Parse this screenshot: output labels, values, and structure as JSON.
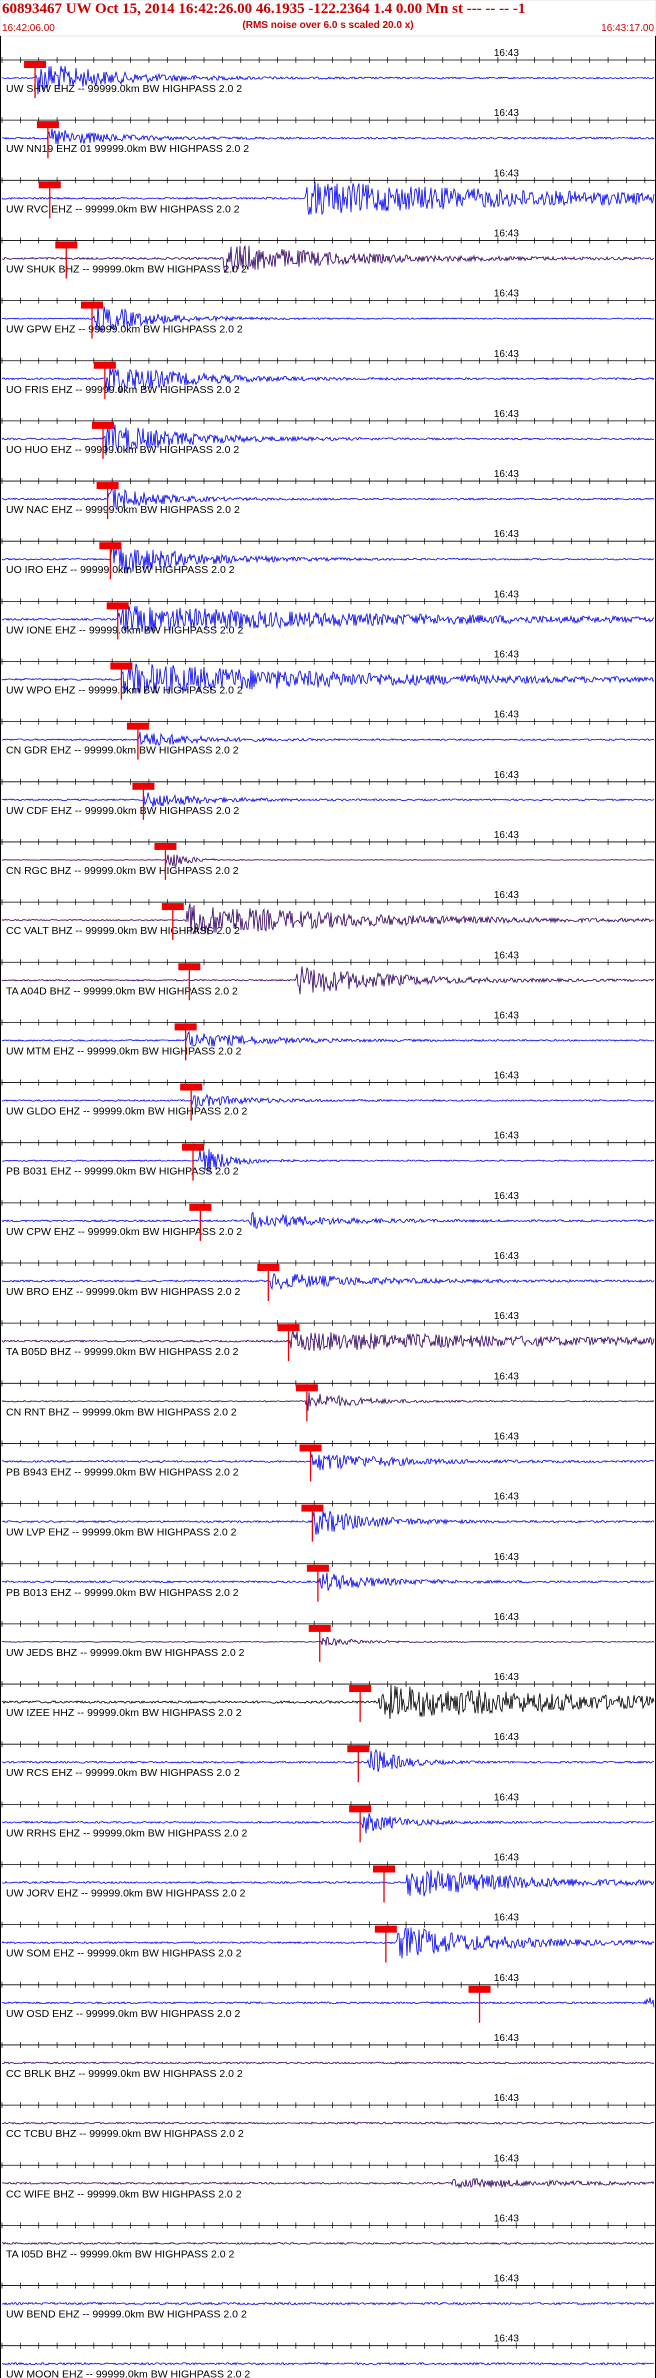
{
  "header": {
    "title": "60893467 UW Oct 15, 2014 16:42:26.00   46.1935 -122.2364  1.4 0.00 Mn st --- -- --   -1",
    "subtitle": "(RMS noise over 6.0 s scaled 20.0 x)",
    "start_time": "16:42:06.00",
    "end_time": "16:43:17.00"
  },
  "colors": {
    "header_band": "#ffffff",
    "header_text": "#cc0000",
    "pick_marker": "#ee0000",
    "axis": "#000000"
  },
  "chart_data": {
    "type": "line",
    "title": "60893467 UW Oct 15, 2014 16:42:26.00   46.1935 -122.2364  1.4 0.00 Mn st --- -- --   -1",
    "subtitle": "(RMS noise over 6.0 s scaled 20.0 x)",
    "xlim": [
      "16:42:06.00",
      "16:43:17.00"
    ],
    "x_tick_label": "16:43",
    "tick_interval_s": 2,
    "time_span_s": 71,
    "grid": false,
    "series": [
      {
        "name": "UW SHW EHZ -- 99999.0km BW  HIGHPASS  2.0  2",
        "color": "#0000ff",
        "pick_s": 3.6,
        "onset_s": 3.6,
        "amp": 1.0,
        "noise": 0.25,
        "dur": 8
      },
      {
        "name": "UW NN19 EHZ 01 99999.0km BW  HIGHPASS  2.0  2",
        "color": "#0000ff",
        "pick_s": 5.0,
        "onset_s": 5.0,
        "amp": 0.6,
        "noise": 0.3,
        "dur": 6
      },
      {
        "name": "UW RVC EHZ -- 99999.0km BW  HIGHPASS  2.0  2",
        "color": "#0000ff",
        "pick_s": 5.2,
        "onset_s": 33.0,
        "amp": 1.0,
        "noise": 0.3,
        "dur": 30
      },
      {
        "name": "UW SHUK BHZ -- 99999.0km BW  HIGHPASS  2.0  2",
        "color": "#330066",
        "pick_s": 7.0,
        "onset_s": 24.0,
        "amp": 0.9,
        "noise": 0.35,
        "dur": 12
      },
      {
        "name": "UW GPW EHZ -- 99999.0km BW  HIGHPASS  2.0  2",
        "color": "#0000ff",
        "pick_s": 9.8,
        "onset_s": 10.0,
        "amp": 0.9,
        "noise": 0.2,
        "dur": 6
      },
      {
        "name": "UO FRIS EHZ -- 99999.0km BW  HIGHPASS  2.0  2",
        "color": "#0000ff",
        "pick_s": 11.2,
        "onset_s": 11.2,
        "amp": 1.0,
        "noise": 0.3,
        "dur": 8
      },
      {
        "name": "UO HUO EHZ -- 99999.0km BW  HIGHPASS  2.0  2",
        "color": "#0000ff",
        "pick_s": 11.0,
        "onset_s": 11.0,
        "amp": 1.0,
        "noise": 0.3,
        "dur": 8
      },
      {
        "name": "UW NAC EHZ -- 99999.0km BW  HIGHPASS  2.0  2",
        "color": "#0000ff",
        "pick_s": 11.5,
        "onset_s": 11.5,
        "amp": 0.8,
        "noise": 0.3,
        "dur": 5
      },
      {
        "name": "UO IRO EHZ -- 99999.0km BW  HIGHPASS  2.0  2",
        "color": "#0000ff",
        "pick_s": 11.8,
        "onset_s": 11.8,
        "amp": 1.0,
        "noise": 0.25,
        "dur": 8
      },
      {
        "name": "UW IONE EHZ -- 99999.0km BW  HIGHPASS  2.0  2",
        "color": "#0000ff",
        "pick_s": 12.6,
        "onset_s": 12.6,
        "amp": 0.8,
        "noise": 0.3,
        "dur": 30
      },
      {
        "name": "UW WPO EHZ -- 99999.0km BW  HIGHPASS  2.0  2",
        "color": "#0000ff",
        "pick_s": 13.0,
        "onset_s": 13.0,
        "amp": 1.0,
        "noise": 0.3,
        "dur": 25
      },
      {
        "name": "CN GDR EHZ -- 99999.0km BW  HIGHPASS  2.0  2",
        "color": "#0000ff",
        "pick_s": 14.8,
        "onset_s": 14.8,
        "amp": 0.5,
        "noise": 0.25,
        "dur": 6
      },
      {
        "name": "UW CDF EHZ -- 99999.0km BW  HIGHPASS  2.0  2",
        "color": "#0000ff",
        "pick_s": 15.4,
        "onset_s": 15.4,
        "amp": 0.5,
        "noise": 0.25,
        "dur": 6
      },
      {
        "name": "CN RGC BHZ -- 99999.0km BW  HIGHPASS  2.0  2",
        "color": "#330066",
        "pick_s": 17.8,
        "onset_s": 17.8,
        "amp": 0.7,
        "noise": 0.1,
        "dur": 2
      },
      {
        "name": "CC VALT BHZ -- 99999.0km BW  HIGHPASS  2.0  2",
        "color": "#330066",
        "pick_s": 18.6,
        "onset_s": 20.0,
        "amp": 1.0,
        "noise": 0.2,
        "dur": 18
      },
      {
        "name": "TA A04D BHZ -- 99999.0km BW  HIGHPASS  2.0  2",
        "color": "#330066",
        "pick_s": 20.4,
        "onset_s": 32.0,
        "amp": 0.9,
        "noise": 0.25,
        "dur": 10
      },
      {
        "name": "UW MTM EHZ -- 99999.0km BW  HIGHPASS  2.0  2",
        "color": "#0000ff",
        "pick_s": 20.0,
        "onset_s": 20.0,
        "amp": 0.5,
        "noise": 0.25,
        "dur": 8
      },
      {
        "name": "UW GLDO EHZ -- 99999.0km BW  HIGHPASS  2.0  2",
        "color": "#0000ff",
        "pick_s": 20.6,
        "onset_s": 20.6,
        "amp": 0.4,
        "noise": 0.25,
        "dur": 6
      },
      {
        "name": "PB B031 EHZ -- 99999.0km BW  HIGHPASS  2.0  2",
        "color": "#0000ff",
        "pick_s": 20.8,
        "onset_s": 21.4,
        "amp": 1.0,
        "noise": 0.2,
        "dur": 3
      },
      {
        "name": "UW CPW EHZ -- 99999.0km BW  HIGHPASS  2.0  2",
        "color": "#0000ff",
        "pick_s": 21.6,
        "onset_s": 27.0,
        "amp": 0.5,
        "noise": 0.3,
        "dur": 8
      },
      {
        "name": "UW BRO EHZ -- 99999.0km BW  HIGHPASS  2.0  2",
        "color": "#0000ff",
        "pick_s": 29.0,
        "onset_s": 29.0,
        "amp": 0.5,
        "noise": 0.3,
        "dur": 10
      },
      {
        "name": "TA B05D BHZ -- 99999.0km BW  HIGHPASS  2.0  2",
        "color": "#330066",
        "pick_s": 31.2,
        "onset_s": 31.2,
        "amp": 0.6,
        "noise": 0.3,
        "dur": 30
      },
      {
        "name": "CN RNT BHZ -- 99999.0km BW  HIGHPASS  2.0  2",
        "color": "#330066",
        "pick_s": 33.2,
        "onset_s": 33.0,
        "amp": 0.6,
        "noise": 0.2,
        "dur": 5
      },
      {
        "name": "PB B943 EHZ -- 99999.0km BW  HIGHPASS  2.0  2",
        "color": "#0000ff",
        "pick_s": 33.6,
        "onset_s": 33.6,
        "amp": 0.6,
        "noise": 0.3,
        "dur": 8
      },
      {
        "name": "UW LVP EHZ -- 99999.0km BW  HIGHPASS  2.0  2",
        "color": "#0000ff",
        "pick_s": 33.8,
        "onset_s": 33.8,
        "amp": 0.8,
        "noise": 0.3,
        "dur": 6
      },
      {
        "name": "PB B013 EHZ -- 99999.0km BW  HIGHPASS  2.0  2",
        "color": "#0000ff",
        "pick_s": 34.4,
        "onset_s": 34.4,
        "amp": 0.6,
        "noise": 0.3,
        "dur": 6
      },
      {
        "name": "UW JEDS BHZ -- 99999.0km BW  HIGHPASS  2.0  2",
        "color": "#330066",
        "pick_s": 34.6,
        "onset_s": 34.6,
        "amp": 0.3,
        "noise": 0.15,
        "dur": 4
      },
      {
        "name": "UW IZEE HHZ -- 99999.0km BW  HIGHPASS  2.0  2",
        "color": "#000000",
        "pick_s": 39.0,
        "onset_s": 41.0,
        "amp": 1.0,
        "noise": 0.4,
        "dur": 25
      },
      {
        "name": "UW RCS EHZ -- 99999.0km BW  HIGHPASS  2.0  2",
        "color": "#0000ff",
        "pick_s": 38.8,
        "onset_s": 39.8,
        "amp": 1.0,
        "noise": 0.3,
        "dur": 3
      },
      {
        "name": "UW RRHS EHZ -- 99999.0km BW  HIGHPASS  2.0  2",
        "color": "#0000ff",
        "pick_s": 39.0,
        "onset_s": 39.0,
        "amp": 0.7,
        "noise": 0.3,
        "dur": 4
      },
      {
        "name": "UW JORV EHZ -- 99999.0km BW  HIGHPASS  2.0  2",
        "color": "#0000ff",
        "pick_s": 41.6,
        "onset_s": 44.0,
        "amp": 0.9,
        "noise": 0.3,
        "dur": 12
      },
      {
        "name": "UW SOM EHZ -- 99999.0km BW  HIGHPASS  2.0  2",
        "color": "#0000ff",
        "pick_s": 41.8,
        "onset_s": 43.0,
        "amp": 1.0,
        "noise": 0.3,
        "dur": 10
      },
      {
        "name": "UW OSD EHZ -- 99999.0km BW  HIGHPASS  2.0  2",
        "color": "#0000ff",
        "pick_s": 52.0,
        "onset_s": 70.0,
        "amp": 0.4,
        "noise": 0.3,
        "dur": 2
      },
      {
        "name": "CC BRLK BHZ -- 99999.0km BW  HIGHPASS  2.0  2",
        "color": "#330066",
        "pick_s": null,
        "onset_s": null,
        "amp": 0,
        "noise": 0.3,
        "dur": 0
      },
      {
        "name": "CC TCBU BHZ -- 99999.0km BW  HIGHPASS  2.0  2",
        "color": "#330066",
        "pick_s": null,
        "onset_s": null,
        "amp": 0,
        "noise": 0.3,
        "dur": 0
      },
      {
        "name": "CC WIFE BHZ -- 99999.0km BW  HIGHPASS  2.0  2",
        "color": "#330066",
        "pick_s": null,
        "onset_s": 49.0,
        "amp": 0.3,
        "noise": 0.3,
        "dur": 10
      },
      {
        "name": "TA I05D BHZ -- 99999.0km BW  HIGHPASS  2.0  2",
        "color": "#330066",
        "pick_s": null,
        "onset_s": null,
        "amp": 0,
        "noise": 0.3,
        "dur": 0
      },
      {
        "name": "UW BEND EHZ -- 99999.0km BW  HIGHPASS  2.0  2",
        "color": "#0000ff",
        "pick_s": null,
        "onset_s": null,
        "amp": 0,
        "noise": 0.35,
        "dur": 0
      },
      {
        "name": "UW MOON EHZ -- 99999.0km BW  HIGHPASS  2.0  2",
        "color": "#0000ff",
        "pick_s": null,
        "onset_s": null,
        "amp": 0,
        "noise": 0.35,
        "dur": 0
      }
    ]
  }
}
